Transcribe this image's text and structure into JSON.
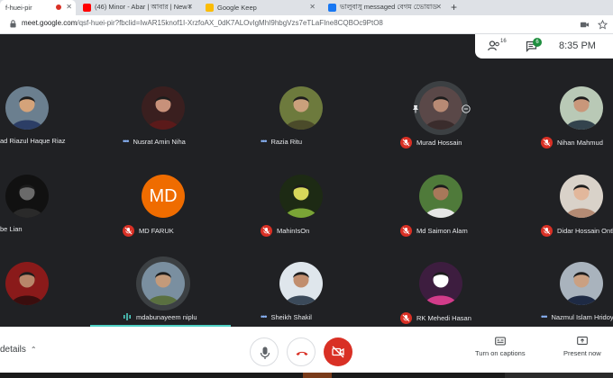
{
  "browser": {
    "tabs": [
      {
        "title": "f-huei-pir",
        "active": true,
        "recording": true
      },
      {
        "title": "(46) Minor - Abar | আবার | New I",
        "active": false
      },
      {
        "title": "Google Keep",
        "active": false
      },
      {
        "title": "ভালুবাসু messaged বেগম ভোেয়াড",
        "active": false
      }
    ],
    "new_tab": "+",
    "url_host": "meet.google.com",
    "url_path": "/qsf-huei-pir?fbclid=IwAR15knof1I-XrzfoAX_0dK7ALOvIgMhI9hbgVzs7eTLaFIne8CQBOc9PtO8"
  },
  "meet_top": {
    "people_count": "16",
    "chat_badge": "6",
    "time": "8:35 PM"
  },
  "participants": [
    {
      "name": "ad Riazul Haque Riaz",
      "status": "none",
      "avatar": "photo-suit"
    },
    {
      "name": "Nusrat Amin Niha",
      "status": "dots",
      "avatar": "photo-girl"
    },
    {
      "name": "Razia Ritu",
      "status": "dots",
      "avatar": "photo-outdoor"
    },
    {
      "name": "Murad Hossain",
      "status": "muted",
      "avatar": "photo-ring"
    },
    {
      "name": "Nihan Mahmud",
      "status": "muted",
      "avatar": "photo-boy"
    },
    {
      "name": "be Lian",
      "status": "none",
      "avatar": "photo-dark"
    },
    {
      "name": "MD FARUK",
      "status": "muted",
      "avatar": "initials",
      "initials": "MD"
    },
    {
      "name": "MahinIsOn",
      "status": "muted",
      "avatar": "photo-logo"
    },
    {
      "name": "Md Saimon Alam",
      "status": "muted",
      "avatar": "photo-green"
    },
    {
      "name": "Didar Hossain Onthor",
      "status": "muted",
      "avatar": "photo-face"
    },
    {
      "name": "",
      "status": "none",
      "avatar": "photo-red"
    },
    {
      "name": "mdabunayeem niplu",
      "status": "speaking",
      "avatar": "photo-ring2"
    },
    {
      "name": "Sheikh Shakil",
      "status": "dots",
      "avatar": "photo-man"
    },
    {
      "name": "RK Mehedi Hasan",
      "status": "muted",
      "avatar": "photo-pink"
    },
    {
      "name": "Nazmul Islam Hridoy",
      "status": "dots",
      "avatar": "photo-uniform"
    }
  ],
  "bottom": {
    "details_label": "details",
    "captions_label": "Turn on captions",
    "present_label": "Present now"
  },
  "colors": {
    "background": "#202124",
    "muted_red": "#d93025",
    "accent_blue": "#8ab4f8",
    "chat_green": "#1e8e3e",
    "speaking_teal": "#4fd1c5"
  }
}
